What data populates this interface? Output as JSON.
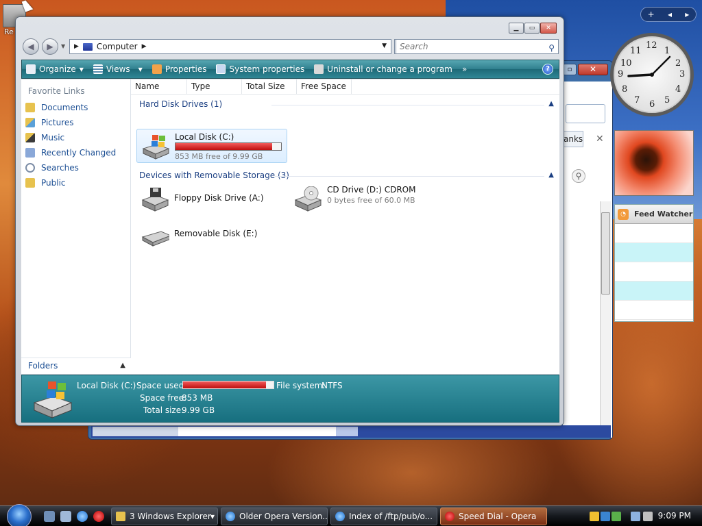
{
  "desktop": {
    "recycle_label": "Re"
  },
  "explorer": {
    "address": {
      "location": "Computer"
    },
    "search": {
      "placeholder": "Search"
    },
    "toolbar": {
      "organize": "Organize",
      "views": "Views",
      "properties": "Properties",
      "system_properties": "System properties",
      "uninstall": "Uninstall or change a program",
      "more": "»",
      "help": "?"
    },
    "nav": {
      "header": "Favorite Links",
      "items": [
        "Documents",
        "Pictures",
        "Music",
        "Recently Changed",
        "Searches",
        "Public"
      ],
      "folders": "Folders"
    },
    "columns": [
      "Name",
      "Type",
      "Total Size",
      "Free Space"
    ],
    "groups": {
      "hard_disks": "Hard Disk Drives (1)",
      "removable": "Devices with Removable Storage (3)"
    },
    "drives": {
      "c": {
        "name": "Local Disk (C:)",
        "free": "853 MB free of 9.99 GB",
        "used_fraction": 0.917
      },
      "a": {
        "name": "Floppy Disk Drive (A:)"
      },
      "d": {
        "name": "CD Drive (D:) CDROM",
        "free": "0 bytes free of 60.0 MB"
      },
      "e": {
        "name": "Removable Disk (E:)"
      }
    },
    "details": {
      "name": "Local Disk (C:)",
      "space_used_label": "Space used:",
      "fs_label": "File system:",
      "fs_value": "NTFS",
      "space_free_label": "Space free:",
      "space_free_value": "853 MB",
      "total_label": "Total size:",
      "total_value": "9.99 GB",
      "used_fraction": 0.917
    }
  },
  "background_window": {
    "partial_button": "anks"
  },
  "gadgets": {
    "clock_numbers": [
      "12",
      "1",
      "2",
      "3",
      "4",
      "5",
      "6",
      "7",
      "8",
      "9",
      "10",
      "11"
    ],
    "feed_title": "Feed Watcher"
  },
  "taskbar": {
    "buttons": [
      {
        "label": "3 Windows Explorer",
        "active": false
      },
      {
        "label": "Older Opera Version...",
        "active": false
      },
      {
        "label": "Index of /ftp/pub/o...",
        "active": false
      },
      {
        "label": "Speed Dial - Opera",
        "active": true
      }
    ],
    "time": "9:09 PM"
  },
  "colors": {
    "toolbar_teal": "#2f7f8e",
    "link_blue": "#1b4e93",
    "capacity_bar_red": "#c00e0e",
    "active_task": "#7a2e14"
  }
}
